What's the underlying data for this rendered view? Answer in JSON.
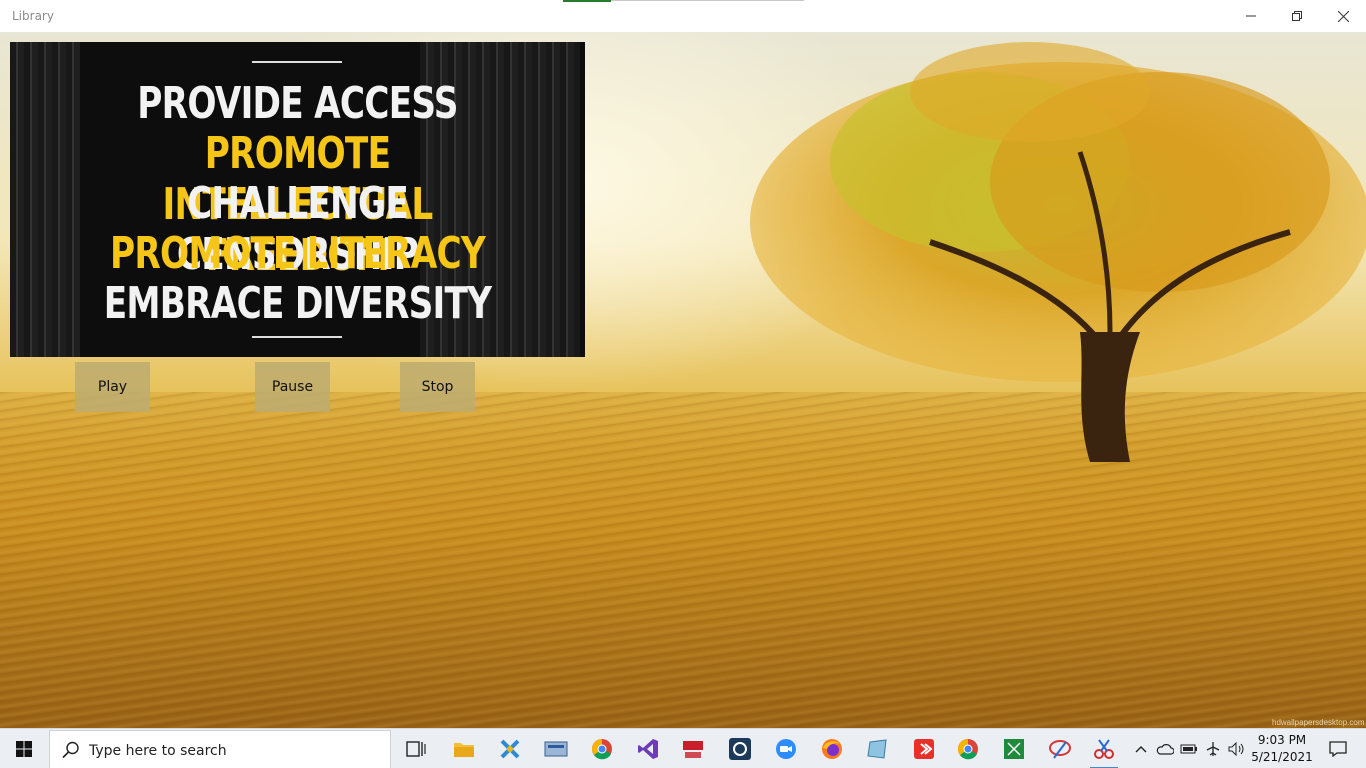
{
  "window": {
    "title": "Library",
    "controls": [
      "minimize-icon",
      "maximize-icon",
      "close-icon"
    ]
  },
  "video": {
    "lines": [
      {
        "text": "PROVIDE ACCESS",
        "color": "white"
      },
      {
        "text": "PROMOTE INTELLECTUAL FREEDOM",
        "color": "yellow"
      },
      {
        "text": "CHALLENGE CENSORSHIP",
        "color": "white"
      },
      {
        "text": "PROMOTE LITERACY",
        "color": "yellow"
      },
      {
        "text": "EMBRACE DIVERSITY",
        "color": "white"
      }
    ],
    "colors": {
      "white": "#f2f2f2",
      "yellow": "#f5c518"
    }
  },
  "controls": {
    "play_label": "Play",
    "pause_label": "Pause",
    "stop_label": "Stop"
  },
  "background": {
    "watermark": "hdwallpapersdesktop.com"
  },
  "taskbar": {
    "search_placeholder": "Type here to search",
    "apps": [
      "task-view-icon",
      "file-explorer-icon",
      "app-icon",
      "app-icon",
      "chrome-icon",
      "visual-studio-icon",
      "app-icon",
      "app-icon",
      "zoom-icon",
      "firefox-icon",
      "app-icon",
      "app-icon",
      "chrome-icon",
      "app-icon",
      "app-icon",
      "app-icon"
    ],
    "clock": {
      "time": "9:03 PM",
      "date": "5/21/2021"
    }
  }
}
